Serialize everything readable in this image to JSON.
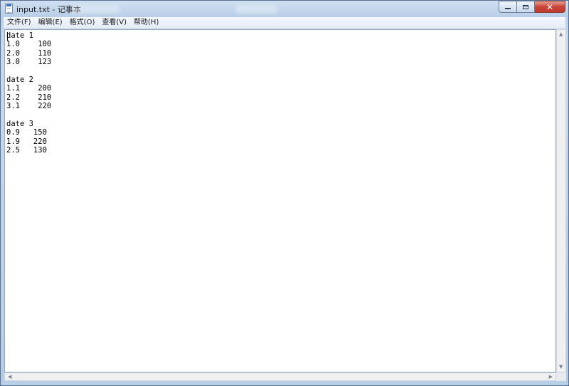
{
  "window": {
    "title": "input.txt - 记事本",
    "buttons": {
      "minimize": "–",
      "maximize": "□",
      "close": "✕"
    }
  },
  "menu": {
    "items": [
      {
        "label": "文件(F)"
      },
      {
        "label": "编辑(E)"
      },
      {
        "label": "格式(O)"
      },
      {
        "label": "查看(V)"
      },
      {
        "label": "帮助(H)"
      }
    ]
  },
  "document": {
    "content": "date 1\n1.0    100\n2.0    110\n3.0    123\n\ndate 2\n1.1    200\n2.2    210\n3.1    220\n\ndate 3\n0.9   150\n1.9   220\n2.5   130"
  },
  "scrollbars": {
    "up": "▲",
    "down": "▼",
    "left": "◀",
    "right": "▶"
  },
  "icons": {
    "app": "notepad-icon",
    "minimize": "minimize-icon",
    "maximize": "maximize-icon",
    "close": "close-icon"
  },
  "colors": {
    "frame": "#b9cfe8",
    "close_button": "#c8453a",
    "editor_background": "#ffffff"
  }
}
